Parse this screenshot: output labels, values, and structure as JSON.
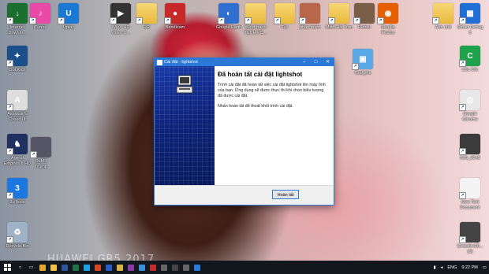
{
  "desktop": {
    "watermark": "HUAWEI GR5  2017",
    "icons_top": [
      {
        "label": "Internet\nDownlo...",
        "name": "idm-icon",
        "color": "#1a6f2e",
        "glyph": "↓"
      },
      {
        "label": "iTunes",
        "name": "itunes-icon",
        "color": "#e94aa7",
        "glyph": "♪"
      },
      {
        "label": "Uplay",
        "name": "uplay-icon",
        "color": "#1b78d3",
        "glyph": "U"
      },
      {
        "label": "WinX HD\nVideo C...",
        "name": "winx-icon",
        "color": "#333333",
        "glyph": "▶"
      },
      {
        "label": "RR",
        "name": "folder-icon",
        "color": "#e9b93d",
        "glyph": ""
      },
      {
        "label": "Bandicam",
        "name": "bandicam-icon",
        "color": "#c82828",
        "glyph": "●"
      },
      {
        "label": "Google Earth",
        "name": "google-earth-icon",
        "color": "#2e6fd0",
        "glyph": "◐"
      },
      {
        "label": "Word tranh\nTECH PC...",
        "name": "folder-icon",
        "color": "#e9b93d",
        "glyph": ""
      },
      {
        "label": "Tex",
        "name": "folder-icon",
        "color": "#e9b93d",
        "glyph": ""
      },
      {
        "label": "phan mem",
        "name": "image-file-icon",
        "color": "#b8674a",
        "glyph": ""
      },
      {
        "label": "Minh Hải Tran",
        "name": "folder-icon",
        "color": "#e9b93d",
        "glyph": ""
      },
      {
        "label": "Retool",
        "name": "image-file-icon",
        "color": "#7a5f48",
        "glyph": ""
      },
      {
        "label": "Mozilla\nFirefox",
        "name": "firefox-icon",
        "color": "#e66000",
        "glyph": "◉"
      },
      {
        "label": "Ảnh nhỏ",
        "name": "folder-icon",
        "color": "#e9b93d",
        "glyph": ""
      }
    ],
    "icons_left": [
      {
        "label": "Dot Kich",
        "name": "dot-kich-icon",
        "color": "#1a4f8a",
        "glyph": "✦"
      },
      {
        "label": "Assassin's\nCreed III",
        "name": "assassins-creed-icon",
        "color": "#ddd",
        "glyph": "A"
      },
      {
        "label": "Age of\nEmpires II HD",
        "name": "age-of-empires-icon",
        "color": "#203060",
        "glyph": "♞"
      },
      {
        "label": "3uTools",
        "name": "3utools-icon",
        "color": "#1c77e0",
        "glyph": "3"
      },
      {
        "label": "Recycle Bin",
        "name": "recycle-bin-icon",
        "color": "#9fb2c6",
        "glyph": "♻"
      }
    ],
    "icons_right": [
      {
        "label": "Smart Defrag\n5",
        "name": "smart-defrag-icon",
        "color": "#1f6fd6",
        "glyph": "▦"
      },
      {
        "label": "Cốc Cốc",
        "name": "coccoc-icon",
        "color": "#1ea34c",
        "glyph": "C"
      },
      {
        "label": "Google\nChrome",
        "name": "chrome-icon",
        "color": "#e8e8e8",
        "glyph": "◎"
      },
      {
        "label": "IMG_0342",
        "name": "image-file-icon",
        "color": "#3b3b3b",
        "glyph": ""
      },
      {
        "label": "New Text\nDocument",
        "name": "text-document-icon",
        "color": "#f4f4f4",
        "glyph": ""
      },
      {
        "label": "Crossfire20...\n(2)",
        "name": "crossfire-icon",
        "color": "#444",
        "glyph": ""
      }
    ],
    "extra_left": [
      {
        "label": "DuMII\nTrump",
        "name": "image-file-icon",
        "color": "#556",
        "glyph": ""
      }
    ],
    "extra_middle": [
      {
        "label": "Gadgets",
        "name": "gadgets-icon",
        "color": "#5aa8e6",
        "glyph": "▣"
      }
    ]
  },
  "dialog": {
    "title": "Cài đặt - lightshot",
    "heading": "Đã hoàn tất cài đặt lightshot",
    "paragraph1": "Trình cài đặt đã hoàn tất việc cài đặt lightshot lên máy tính của bạn. Ứng dụng sẽ được thực thi khi chọn biểu tượng đã được cài đặt.",
    "paragraph2": "Nhấn hoàn tất để thoát khỏi trình cài đặt.",
    "finish_label": "Hoàn tất",
    "minimize": "–",
    "maximize": "□",
    "close": "✕"
  },
  "taskbar": {
    "apps": [
      {
        "name": "search-icon",
        "glyph": "○",
        "color": ""
      },
      {
        "name": "task-view-icon",
        "glyph": "▭",
        "color": ""
      },
      {
        "name": "chrome-taskbar-icon",
        "glyph": "",
        "color": "#e4a72c"
      },
      {
        "name": "file-explorer-icon",
        "glyph": "",
        "color": "#f1c34a"
      },
      {
        "name": "word-icon",
        "glyph": "",
        "color": "#2b579a"
      },
      {
        "name": "excel-icon",
        "glyph": "",
        "color": "#217346"
      },
      {
        "name": "ie-icon",
        "glyph": "",
        "color": "#1fa1e1"
      },
      {
        "name": "powerpoint-icon",
        "glyph": "",
        "color": "#d24726"
      },
      {
        "name": "photoshop-icon",
        "glyph": "",
        "color": "#2b5ac9"
      },
      {
        "name": "folder-taskbar-icon",
        "glyph": "",
        "color": "#d8b54a"
      },
      {
        "name": "onenote-icon",
        "glyph": "",
        "color": "#8b3aa8"
      },
      {
        "name": "app-icon",
        "glyph": "",
        "color": "#3c8fd8"
      },
      {
        "name": "app-icon",
        "glyph": "",
        "color": "#c52b2b"
      },
      {
        "name": "app-icon",
        "glyph": "",
        "color": "#666"
      },
      {
        "name": "app-icon",
        "glyph": "",
        "color": "#444"
      },
      {
        "name": "app-icon",
        "glyph": "",
        "color": "#666"
      },
      {
        "name": "installer-taskbar-icon",
        "glyph": "",
        "color": "#2b78d6"
      }
    ],
    "language": "ENG",
    "time": "9:22 PM"
  }
}
